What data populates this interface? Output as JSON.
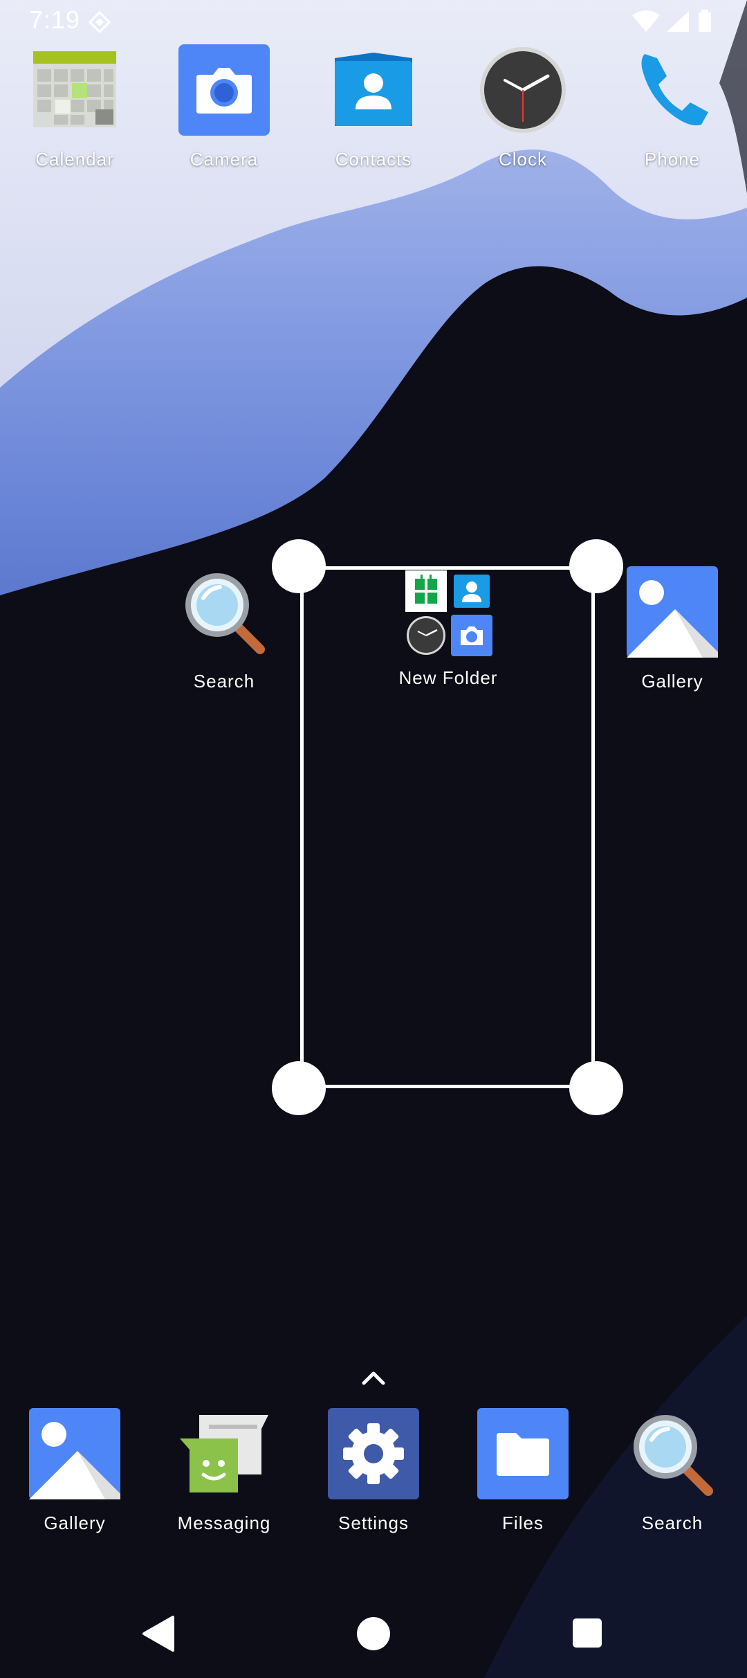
{
  "status_bar": {
    "time": "7:19"
  },
  "home_row": [
    {
      "label": "Calendar",
      "icon": "calendar-icon"
    },
    {
      "label": "Camera",
      "icon": "camera-icon"
    },
    {
      "label": "Contacts",
      "icon": "contacts-icon"
    },
    {
      "label": "Clock",
      "icon": "clock-icon"
    },
    {
      "label": "Phone",
      "icon": "phone-icon"
    }
  ],
  "middle_row": {
    "search": {
      "label": "Search",
      "icon": "magnifier-icon"
    },
    "folder": {
      "label": "New Folder",
      "icon": "folder-icon",
      "contents": [
        "calendar-icon",
        "contacts-icon",
        "clock-icon",
        "camera-icon"
      ]
    },
    "gallery": {
      "label": "Gallery",
      "icon": "gallery-icon"
    }
  },
  "dock": [
    {
      "label": "Gallery",
      "icon": "gallery-icon"
    },
    {
      "label": "Messaging",
      "icon": "messaging-icon"
    },
    {
      "label": "Settings",
      "icon": "settings-icon"
    },
    {
      "label": "Files",
      "icon": "files-icon"
    },
    {
      "label": "Search",
      "icon": "magnifier-icon"
    }
  ],
  "colors": {
    "accent_blue": "#4f86f7",
    "wallpaper_dark": "#0d0d18",
    "wallpaper_light": "#e4e6f4"
  }
}
